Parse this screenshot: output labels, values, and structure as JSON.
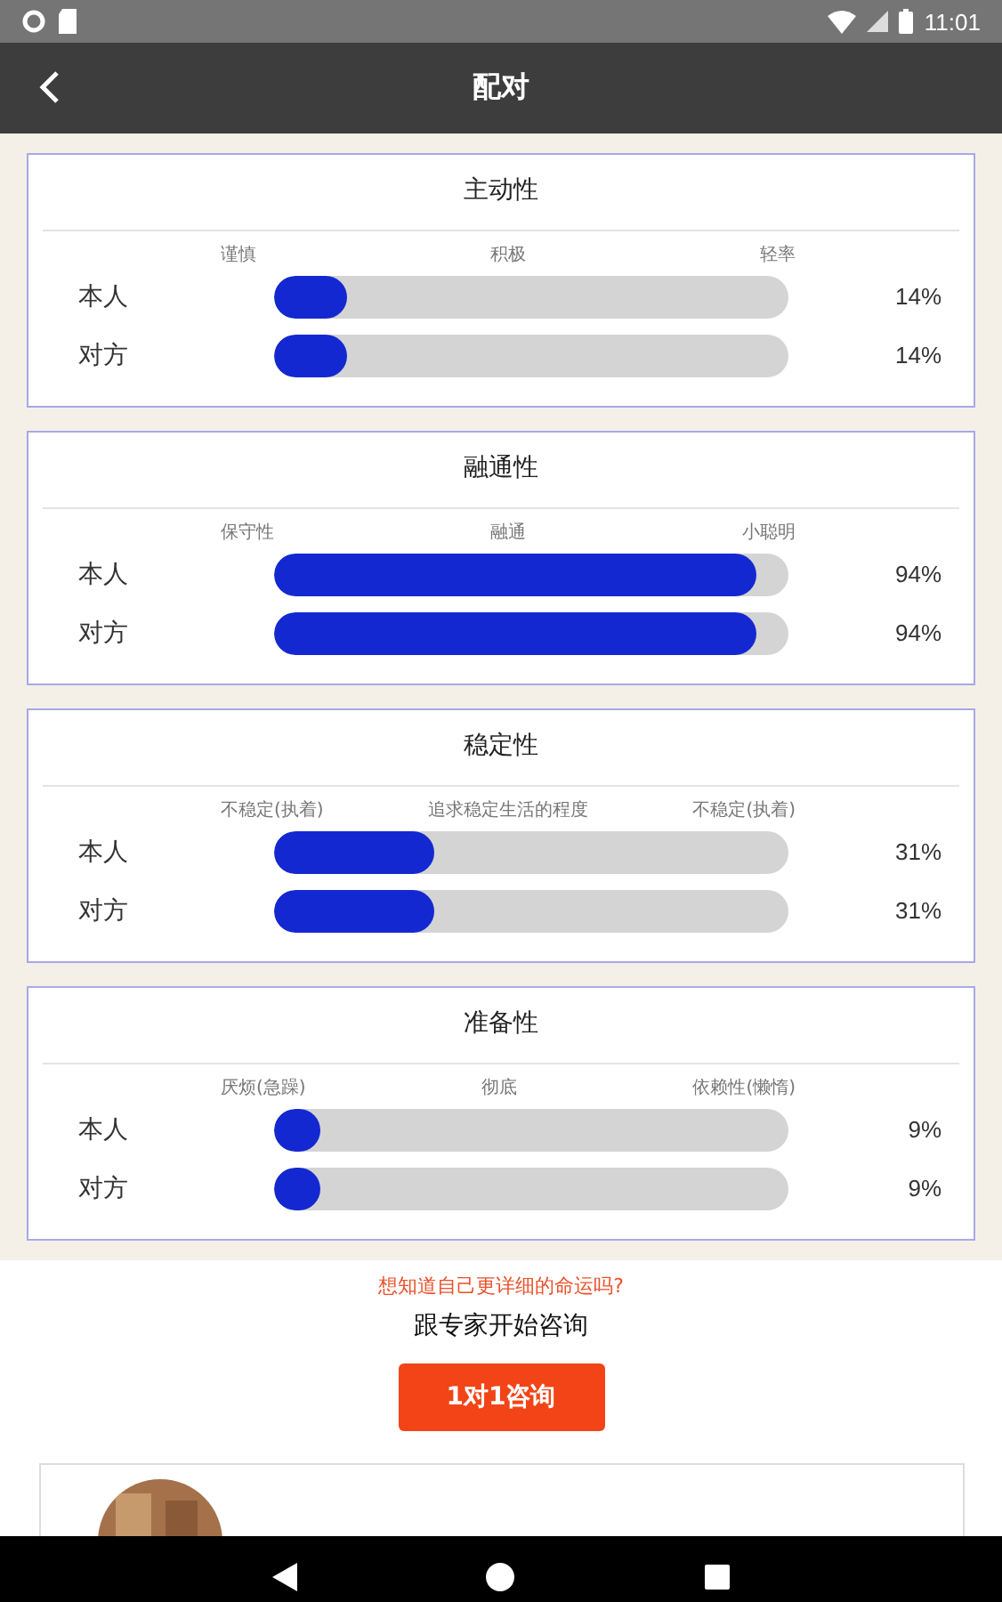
{
  "status_bar": {
    "time": "11:01"
  },
  "app_bar": {
    "title": "配对"
  },
  "cards": [
    {
      "title": "主动性",
      "scale": [
        "谨慎",
        "积极",
        "轻率"
      ],
      "rows": [
        {
          "label": "本人",
          "level": 0.14,
          "reading": "14%"
        },
        {
          "label": "对方",
          "level": 0.14,
          "reading": "14%"
        }
      ]
    },
    {
      "title": "融通性",
      "scale": [
        "保守性",
        "融通",
        "小聪明"
      ],
      "rows": [
        {
          "label": "本人",
          "level": 0.94,
          "reading": "94%"
        },
        {
          "label": "对方",
          "level": 0.94,
          "reading": "94%"
        }
      ]
    },
    {
      "title": "稳定性",
      "scale": [
        "不稳定(执着)",
        "追求稳定生活的程度",
        "不稳定(执着)"
      ],
      "rows": [
        {
          "label": "本人",
          "level": 0.31,
          "reading": "31%"
        },
        {
          "label": "对方",
          "level": 0.31,
          "reading": "31%"
        }
      ]
    },
    {
      "title": "准备性",
      "scale": [
        "厌烦(急躁)",
        "彻底",
        "依赖性(懒惰)"
      ],
      "rows": [
        {
          "label": "本人",
          "level": 0.09,
          "reading": "9%"
        },
        {
          "label": "对方",
          "level": 0.09,
          "reading": "9%"
        }
      ]
    }
  ],
  "promo": {
    "question": "想知道自己更详细的命运吗?",
    "headline": "跟专家开始咨询",
    "button": "1对1咨询"
  }
}
